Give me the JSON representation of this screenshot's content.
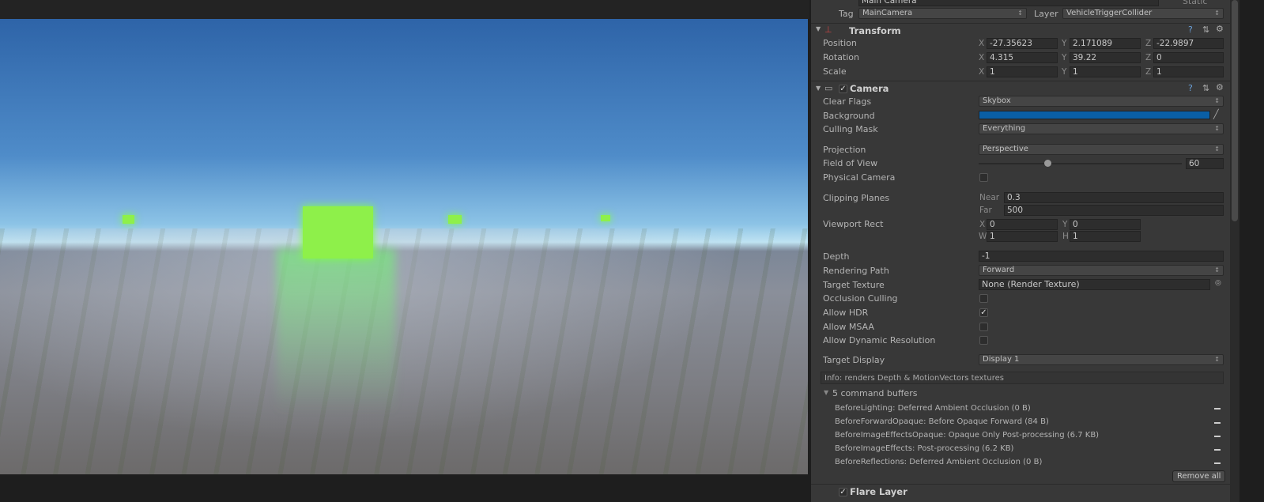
{
  "header": {
    "object_name": "Main Camera",
    "static_label": "Static",
    "tag_label": "Tag",
    "tag_value": "MainCamera",
    "layer_label": "Layer",
    "layer_value": "VehicleTriggerCollider"
  },
  "transform": {
    "title": "Transform",
    "rows": [
      {
        "label": "Position",
        "x": "-27.35623",
        "y": "2.171089",
        "z": "-22.9897"
      },
      {
        "label": "Rotation",
        "x": "4.315",
        "y": "39.22",
        "z": "0"
      },
      {
        "label": "Scale",
        "x": "1",
        "y": "1",
        "z": "1"
      }
    ],
    "axes": {
      "x": "X",
      "y": "Y",
      "z": "Z"
    }
  },
  "camera": {
    "title": "Camera",
    "enabled": true,
    "clear_flags": {
      "label": "Clear Flags",
      "value": "Skybox"
    },
    "background": {
      "label": "Background",
      "color": "#0a5fa5"
    },
    "culling_mask": {
      "label": "Culling Mask",
      "value": "Everything"
    },
    "projection": {
      "label": "Projection",
      "value": "Perspective"
    },
    "fov": {
      "label": "Field of View",
      "value": "60",
      "min": 1,
      "max": 179
    },
    "physical": {
      "label": "Physical Camera",
      "checked": false
    },
    "clipping": {
      "label": "Clipping Planes",
      "near_label": "Near",
      "near": "0.3",
      "far_label": "Far",
      "far": "500"
    },
    "viewport": {
      "label": "Viewport Rect",
      "x_label": "X",
      "x": "0",
      "y_label": "Y",
      "y": "0",
      "w_label": "W",
      "w": "1",
      "h_label": "H",
      "h": "1"
    },
    "depth": {
      "label": "Depth",
      "value": "-1"
    },
    "rendering_path": {
      "label": "Rendering Path",
      "value": "Forward"
    },
    "target_texture": {
      "label": "Target Texture",
      "value": "None (Render Texture)"
    },
    "occlusion": {
      "label": "Occlusion Culling",
      "checked": false
    },
    "hdr": {
      "label": "Allow HDR",
      "checked": true
    },
    "msaa": {
      "label": "Allow MSAA",
      "checked": false
    },
    "dynres": {
      "label": "Allow Dynamic Resolution",
      "checked": false
    },
    "target_display": {
      "label": "Target Display",
      "value": "Display 1"
    },
    "info": "Info: renders Depth & MotionVectors textures",
    "buffers_title": "5 command buffers",
    "buffers": [
      "BeforeLighting: Deferred Ambient Occlusion (0 B)",
      "BeforeForwardOpaque: Before Opaque Forward (84 B)",
      "BeforeImageEffectsOpaque: Opaque Only Post-processing (6.7 KB)",
      "BeforeImageEffects: Post-processing (6.2 KB)",
      "BeforeReflections: Deferred Ambient Occlusion (0 B)"
    ],
    "remove_all": "Remove all"
  },
  "next_component": "Flare Layer",
  "icons": {
    "help": "?",
    "preset": "⇅",
    "gear": "⚙"
  }
}
